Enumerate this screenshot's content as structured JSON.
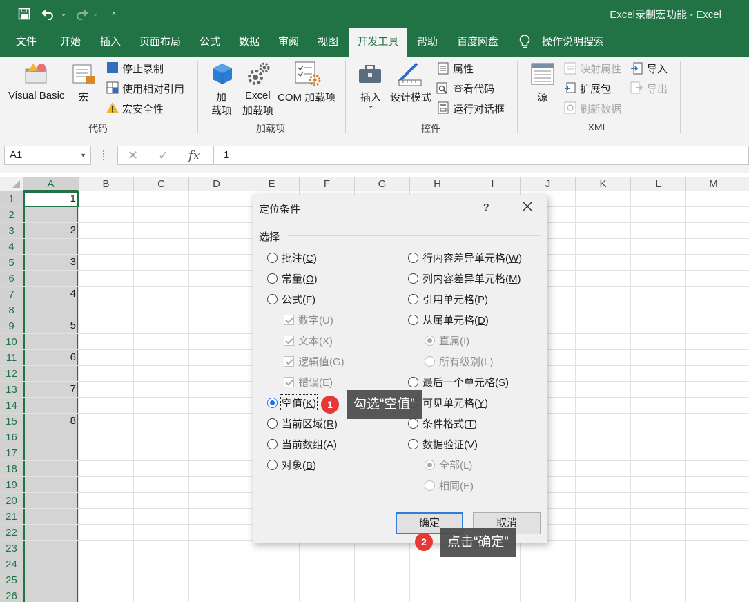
{
  "titlebar": {
    "title": "Excel录制宏功能  -  Excel"
  },
  "tabs": [
    {
      "label": "文件"
    },
    {
      "label": "开始"
    },
    {
      "label": "插入"
    },
    {
      "label": "页面布局"
    },
    {
      "label": "公式"
    },
    {
      "label": "数据"
    },
    {
      "label": "审阅"
    },
    {
      "label": "视图"
    },
    {
      "label": "开发工具"
    },
    {
      "label": "帮助"
    },
    {
      "label": "百度网盘"
    },
    {
      "label": "操作说明搜索"
    }
  ],
  "ribbon": {
    "code": {
      "visual_basic": "Visual Basic",
      "macros": "宏",
      "stop_recording": "停止录制",
      "relative_ref": "使用相对引用",
      "macro_security": "宏安全性",
      "label": "代码"
    },
    "addins": {
      "addins_line1": "加",
      "addins_line2": "载项",
      "excel_addins_line1": "Excel",
      "excel_addins_line2": "加载项",
      "com_addins": "COM 加载项",
      "label": "加载项"
    },
    "controls": {
      "insert": "插入",
      "design_mode": "设计模式",
      "properties": "属性",
      "view_code": "查看代码",
      "run_dialog": "运行对话框",
      "label": "控件"
    },
    "xml": {
      "source": "源",
      "map_properties": "映射属性",
      "expansion_pack": "扩展包",
      "refresh_data": "刷新数据",
      "import": "导入",
      "export": "导出",
      "label": "XML"
    }
  },
  "formula_bar": {
    "name_box": "A1",
    "fx": "fx",
    "content": "1"
  },
  "grid": {
    "columns": [
      "A",
      "B",
      "C",
      "D",
      "E",
      "F",
      "G",
      "H",
      "I",
      "J",
      "K",
      "L",
      "M"
    ],
    "rows": [
      "1",
      "2",
      "3",
      "4",
      "5",
      "6",
      "7",
      "8",
      "9",
      "10",
      "11",
      "12",
      "13",
      "14",
      "15",
      "16",
      "17",
      "18",
      "19",
      "20",
      "21",
      "22",
      "23",
      "24",
      "25",
      "26"
    ],
    "column_a_values": [
      {
        "row": 1,
        "value": "1"
      },
      {
        "row": 3,
        "value": "2"
      },
      {
        "row": 5,
        "value": "3"
      },
      {
        "row": 7,
        "value": "4"
      },
      {
        "row": 9,
        "value": "5"
      },
      {
        "row": 11,
        "value": "6"
      },
      {
        "row": 13,
        "value": "7"
      },
      {
        "row": 15,
        "value": "8"
      }
    ]
  },
  "dialog": {
    "title": "定位条件",
    "help": "?",
    "group_label": "选择",
    "left_options": [
      {
        "text": "批注(",
        "key": "C",
        "tail": ")"
      },
      {
        "text": "常量(",
        "key": "O",
        "tail": ")"
      },
      {
        "text": "公式(",
        "key": "F",
        "tail": ")"
      },
      {
        "text": "数字(U)"
      },
      {
        "text": "文本(X)"
      },
      {
        "text": "逻辑值(G)"
      },
      {
        "text": "错误(E)"
      },
      {
        "text": "空值(",
        "key": "K",
        "tail": ")"
      },
      {
        "text": "当前区域(",
        "key": "R",
        "tail": ")"
      },
      {
        "text": "当前数组(",
        "key": "A",
        "tail": ")"
      },
      {
        "text": "对象(",
        "key": "B",
        "tail": ")"
      }
    ],
    "right_options": [
      {
        "text": "行内容差异单元格(",
        "key": "W",
        "tail": ")"
      },
      {
        "text": "列内容差异单元格(",
        "key": "M",
        "tail": ")"
      },
      {
        "text": "引用单元格(",
        "key": "P",
        "tail": ")"
      },
      {
        "text": "从属单元格(",
        "key": "D",
        "tail": ")"
      },
      {
        "text": "直属(I)"
      },
      {
        "text": "所有级别(L)"
      },
      {
        "text": "最后一个单元格(",
        "key": "S",
        "tail": ")"
      },
      {
        "text": "可见单元格(",
        "key": "Y",
        "tail": ")"
      },
      {
        "text": "条件格式(",
        "key": "T",
        "tail": ")"
      },
      {
        "text": "数据验证(",
        "key": "V",
        "tail": ")"
      },
      {
        "text": "全部(L)"
      },
      {
        "text": "相同(E)"
      }
    ],
    "selected_option": "空值",
    "ok": "确定",
    "cancel": "取消"
  },
  "annotations": [
    {
      "number": "1",
      "text": "勾选“空值”"
    },
    {
      "number": "2",
      "text": "点击“确定”"
    }
  ],
  "colors": {
    "accent": "#217346",
    "badge": "#e53935",
    "radio_selected": "#1a73e8"
  }
}
